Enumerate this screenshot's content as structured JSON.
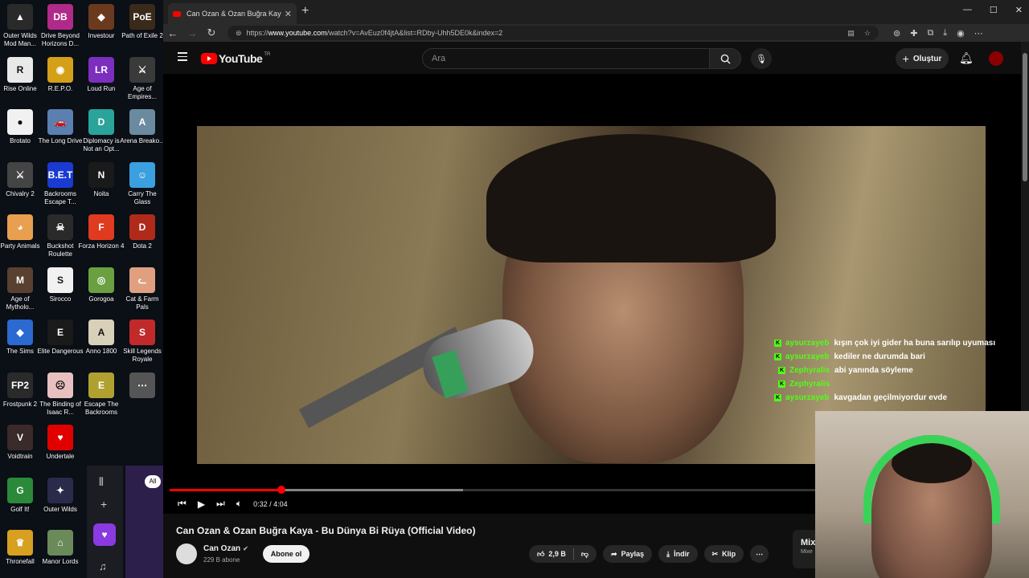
{
  "desktop": {
    "icons": [
      {
        "label": "Outer Wilds Mod Man...",
        "color": "#2a2a2a",
        "glyph": "▲"
      },
      {
        "label": "Drive Beyond Horizons D...",
        "color": "#b02a8a",
        "glyph": "DB"
      },
      {
        "label": "Investour",
        "color": "#6b3a1e",
        "glyph": "◆"
      },
      {
        "label": "Path of Exile 2",
        "color": "#3a2a1a",
        "glyph": "PoE"
      },
      {
        "label": "Rise Online",
        "color": "#e9e9e9",
        "glyph": "R"
      },
      {
        "label": "R.E.P.O.",
        "color": "#d4a017",
        "glyph": "◉"
      },
      {
        "label": "Loud Run",
        "color": "#7b2fbe",
        "glyph": "LR"
      },
      {
        "label": "Age of Empires...",
        "color": "#3a3a3a",
        "glyph": "⚔"
      },
      {
        "label": "Brotato",
        "color": "#f1f1f1",
        "glyph": "●"
      },
      {
        "label": "The Long Drive",
        "color": "#5a7fb0",
        "glyph": "🚗"
      },
      {
        "label": "Diplomacy is Not an Opt...",
        "color": "#2aa39a",
        "glyph": "D"
      },
      {
        "label": "Arena Breako...",
        "color": "#6a8aa0",
        "glyph": "A"
      },
      {
        "label": "Chivalry 2",
        "color": "#444",
        "glyph": "⚔"
      },
      {
        "label": "Backrooms Escape T...",
        "color": "#1a3ad1",
        "glyph": "B.E.T"
      },
      {
        "label": "Noita",
        "color": "#1a1a1a",
        "glyph": "N"
      },
      {
        "label": "Carry The Glass",
        "color": "#3aa0e0",
        "glyph": "☺"
      },
      {
        "label": "Party Animals",
        "color": "#e8a050",
        "glyph": "◕"
      },
      {
        "label": "Buckshot Roulette",
        "color": "#2a2a2a",
        "glyph": "☠"
      },
      {
        "label": "Forza Horizon 4",
        "color": "#e03a20",
        "glyph": "F"
      },
      {
        "label": "Dota 2",
        "color": "#b02a1a",
        "glyph": "D"
      },
      {
        "label": "Age of Mytholo...",
        "color": "#5a4030",
        "glyph": "M"
      },
      {
        "label": "Sirocco",
        "color": "#f1f1f1",
        "glyph": "S"
      },
      {
        "label": "Gorogoa",
        "color": "#6aa040",
        "glyph": "◎"
      },
      {
        "label": "Cat & Farm Pals",
        "color": "#e0a080",
        "glyph": "ᓚ"
      },
      {
        "label": "The Sims",
        "color": "#2a6ad1",
        "glyph": "◆"
      },
      {
        "label": "Elite Dangerous",
        "color": "#1a1a1a",
        "glyph": "E"
      },
      {
        "label": "Anno 1800",
        "color": "#d8d0b8",
        "glyph": "A"
      },
      {
        "label": "Skill Legends Royale",
        "color": "#c02a2a",
        "glyph": "S"
      },
      {
        "label": "Frostpunk 2",
        "color": "#2a2a2a",
        "glyph": "FP2"
      },
      {
        "label": "The Binding of Isaac R...",
        "color": "#e8c0c0",
        "glyph": "☹"
      },
      {
        "label": "Escape The Backrooms",
        "color": "#b0a030",
        "glyph": "E"
      },
      {
        "label": "",
        "color": "#555",
        "glyph": "⋯"
      },
      {
        "label": "Voidtrain",
        "color": "#3a2a2a",
        "glyph": "V"
      },
      {
        "label": "Undertale",
        "color": "#e00000",
        "glyph": "♥"
      },
      {
        "label": "",
        "color": "transparent",
        "glyph": ""
      },
      {
        "label": "",
        "color": "transparent",
        "glyph": ""
      },
      {
        "label": "Golf It!",
        "color": "#2a8a3a",
        "glyph": "G"
      },
      {
        "label": "Outer Wilds",
        "color": "#2a2a4a",
        "glyph": "✦"
      },
      {
        "label": "",
        "color": "transparent",
        "glyph": ""
      },
      {
        "label": "",
        "color": "transparent",
        "glyph": ""
      },
      {
        "label": "Thronefall",
        "color": "#d8a020",
        "glyph": "♛"
      },
      {
        "label": "Manor Lords",
        "color": "#6a8a5a",
        "glyph": "⌂"
      }
    ],
    "widget_all": "All"
  },
  "browser": {
    "tab_title": "Can Ozan & Ozan Buğra Kaya - Bu",
    "url_prefix": "https://",
    "url_domain": "www.youtube.com",
    "url_path": "/watch?v=AvEuz0f4jtA&list=RDby-Uhh5DE0k&index=2"
  },
  "youtube": {
    "country": "TR",
    "search_placeholder": "Ara",
    "create_label": "Oluştur",
    "video_title": "Can Ozan & Ozan Buğra Kaya - Bu Dünya Bi Rüya (Official Video)",
    "channel_name": "Can Ozan",
    "subscribers": "229 B abone",
    "subscribe_label": "Abone ol",
    "likes": "2,9 B",
    "share_label": "Paylaş",
    "download_label": "İndir",
    "clip_label": "Klip",
    "mix_title": "Mix",
    "mix_sub": "Mixe",
    "time_display": "0:32 / 4:04",
    "progress_fraction": 0.1311,
    "buffered_fraction": 0.345,
    "accent": "#ff0000"
  },
  "chat": [
    {
      "user": "aysurzayeb",
      "msg": "kışın çok iyi gider ha buna sarılıp uyuması"
    },
    {
      "user": "aysurzayeb",
      "msg": "kediler ne durumda bari"
    },
    {
      "user": "Zephyralis",
      "msg": "abi yanında söyleme"
    },
    {
      "user": "Zephyralis",
      "msg": ""
    },
    {
      "user": "aysurzayeb",
      "msg": "kavgadan geçilmiyordur evde"
    }
  ],
  "chat_accent": "#53fc18"
}
